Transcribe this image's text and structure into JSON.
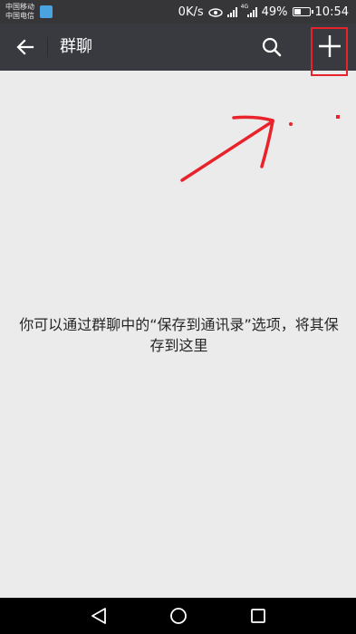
{
  "status_bar": {
    "carrier_1": "中国移动",
    "carrier_2": "中国电信",
    "net_speed": "0K/s",
    "network_type": "4G",
    "battery_percent": "49%",
    "battery_level": 0.49,
    "time": "10:54"
  },
  "toolbar": {
    "title": "群聊",
    "back_icon": "arrow-left-icon",
    "search_icon": "search-icon",
    "add_icon": "plus-icon"
  },
  "main": {
    "empty_message": "你可以通过群聊中的“保存到通讯录”选项，将其保存到这里"
  },
  "annotation": {
    "color": "#e8232b"
  },
  "nav_bar": {
    "back_icon": "triangle-back-icon",
    "home_icon": "circle-home-icon",
    "recents_icon": "square-recents-icon"
  },
  "colors": {
    "toolbar_bg": "#393a3f",
    "page_bg": "#ebebeb"
  }
}
